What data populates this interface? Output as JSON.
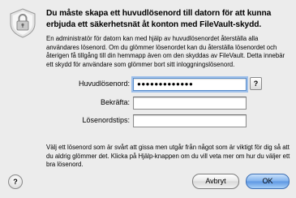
{
  "dialog": {
    "title": "Du måste skapa ett huvudlösenord till datorn för att kunna erbjuda ett säkerhetsnät åt konton med FileVault-skydd.",
    "intro": "En administratör för datorn kan med hjälp av huvudlösenordet återställa alla användares lösenord. Om du glömmer lösenordet kan du återställa lösenordet och återigen få tillgång till din hemmapp även om den skyddas av FileVault. Detta innebär ett skydd för användare som glömmer bort sitt inloggningslösenord.",
    "fields": {
      "master_password": {
        "label": "Huvudlösenord:",
        "value": "●●●●●●●●●●●●●"
      },
      "verify": {
        "label": "Bekräfta:",
        "value": ""
      },
      "hint": {
        "label": "Lösenordstips:",
        "value": ""
      }
    },
    "password_assistant_label": "?",
    "footer_text": "Välj ett lösenord som är svårt att gissa men utgår från något som är viktigt för dig så att du aldrig glömmer det. Klicka på Hjälp-knappen om du vill veta mer om hur du väljer ett bra lösenord.",
    "help_label": "?",
    "cancel_label": "Avbryt",
    "ok_label": "OK"
  }
}
